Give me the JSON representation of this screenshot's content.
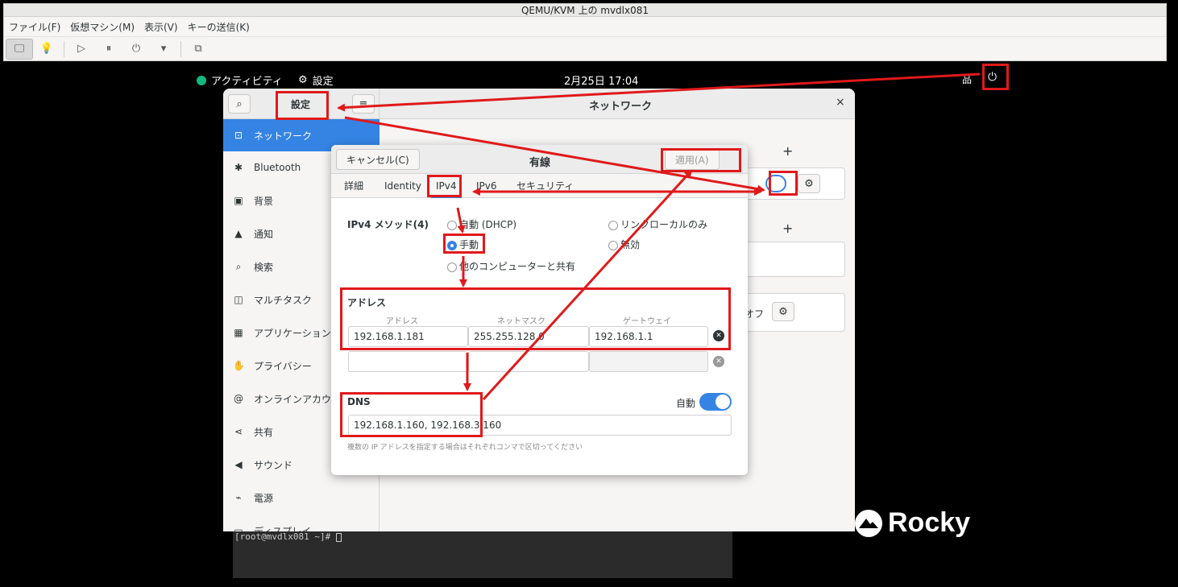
{
  "qemu": {
    "title": "QEMU/KVM 上の mvdlx081",
    "menu": [
      "ファイル(F)",
      "仮想マシン(M)",
      "表示(V)",
      "キーの送信(K)"
    ]
  },
  "topbar": {
    "activities": "アクティビティ",
    "app": "設定",
    "clock": "2月25日  17:04"
  },
  "settings": {
    "sidebar_title": "設定",
    "main_title": "ネットワーク",
    "close": "×",
    "sidebar": [
      {
        "icon": "network-icon",
        "glyph": "⊡",
        "label": "ネットワーク"
      },
      {
        "icon": "bluetooth-icon",
        "glyph": "✱",
        "label": "Bluetooth"
      },
      {
        "icon": "background-icon",
        "glyph": "▣",
        "label": "背景"
      },
      {
        "icon": "bell-icon",
        "glyph": "▲",
        "label": "通知"
      },
      {
        "icon": "search-icon",
        "glyph": "⌕",
        "label": "検索"
      },
      {
        "icon": "multitask-icon",
        "glyph": "◫",
        "label": "マルチタスク"
      },
      {
        "icon": "apps-icon",
        "glyph": "▦",
        "label": "アプリケーション"
      },
      {
        "icon": "privacy-icon",
        "glyph": "✋",
        "label": "プライバシー"
      },
      {
        "icon": "online-accounts-icon",
        "glyph": "@",
        "label": "オンラインアカウ"
      },
      {
        "icon": "share-icon",
        "glyph": "⋖",
        "label": "共有"
      },
      {
        "icon": "sound-icon",
        "glyph": "◀",
        "label": "サウンド"
      },
      {
        "icon": "power-icon",
        "glyph": "⌁",
        "label": "電源"
      },
      {
        "icon": "display-icon",
        "glyph": "▭",
        "label": "ディスプレイ"
      }
    ],
    "main_snippet": "オフ"
  },
  "dialog": {
    "cancel": "キャンセル(C)",
    "title": "有線",
    "apply": "適用(A)",
    "tabs": [
      "詳細",
      "Identity",
      "IPv4",
      "IPv6",
      "セキュリティ"
    ],
    "method_label": "IPv4 メソッド(4)",
    "methods": {
      "dhcp": "自動 (DHCP)",
      "link_local": "リンクローカルのみ",
      "manual": "手動",
      "disabled": "無効",
      "shared": "他のコンピューターと共有"
    },
    "address": {
      "section": "アドレス",
      "col_address": "アドレス",
      "col_netmask": "ネットマスク",
      "col_gateway": "ゲートウェイ",
      "rows": [
        {
          "address": "192.168.1.181",
          "netmask": "255.255.128.0",
          "gateway": "192.168.1.1"
        },
        {
          "address": "",
          "netmask": "",
          "gateway": ""
        }
      ]
    },
    "dns": {
      "section": "DNS",
      "auto_label": "自動",
      "auto_on": true,
      "value": "192.168.1.160, 192.168.3.160",
      "hint": "複数の IP アドレスを指定する場合はそれぞれコンマで区切ってください"
    }
  },
  "terminal": {
    "prompt": "[root@mvdlx081 ~]# "
  },
  "brand": {
    "rocky": "Rocky"
  },
  "colors": {
    "accent": "#3584e4",
    "annotation": "#e0191b"
  }
}
